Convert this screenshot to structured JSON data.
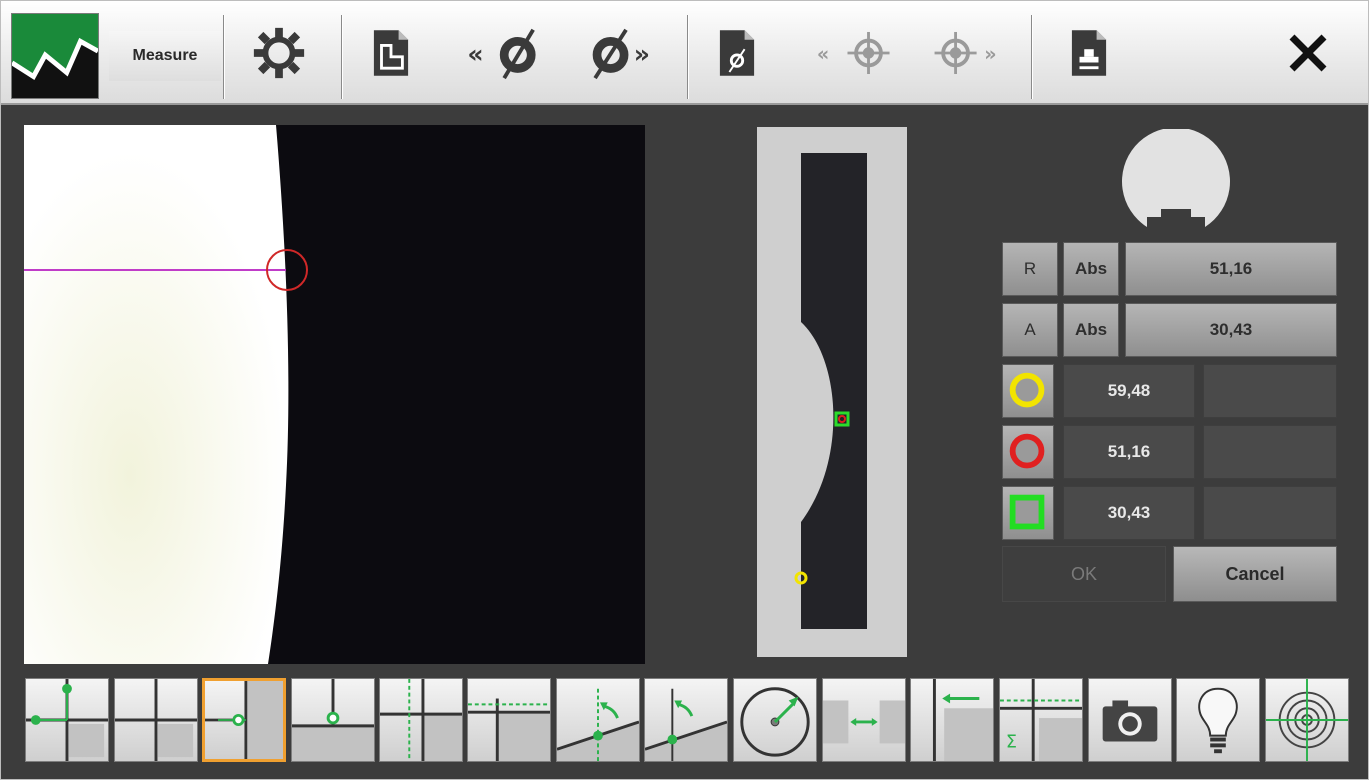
{
  "toolbar": {
    "measure_label": "Measure",
    "icons": [
      "logo-icon",
      "gear-icon",
      "new-document-icon",
      "previous-measurement-icon",
      "next-measurement-icon",
      "measurement-document-icon",
      "previous-target-icon",
      "next-target-icon",
      "print-icon",
      "close-icon"
    ]
  },
  "panel": {
    "r_label": "R",
    "r_mode": "Abs",
    "r_value": "51,16",
    "a_label": "A",
    "a_mode": "Abs",
    "a_value": "30,43",
    "results": [
      {
        "indicator": "yellow-circle",
        "color": "#f2e400",
        "value": "59,48"
      },
      {
        "indicator": "red-circle",
        "color": "#e02020",
        "value": "51,16"
      },
      {
        "indicator": "green-square",
        "color": "#22dd22",
        "value": "30,43"
      }
    ],
    "ok_label": "OK",
    "cancel_label": "Cancel"
  },
  "tools": [
    {
      "name": "cross-point-tool-icon"
    },
    {
      "name": "crosshair-tool-icon"
    },
    {
      "name": "edge-point-tool-icon",
      "active": true
    },
    {
      "name": "bottom-edge-point-tool-icon"
    },
    {
      "name": "vertical-line-tool-icon"
    },
    {
      "name": "horizontal-line-tool-icon"
    },
    {
      "name": "angle-tool-icon"
    },
    {
      "name": "angle-edge-tool-icon"
    },
    {
      "name": "radius-tool-icon"
    },
    {
      "name": "distance-tool-icon"
    },
    {
      "name": "offset-tool-icon"
    },
    {
      "name": "sum-tool-icon"
    },
    {
      "name": "camera-icon"
    },
    {
      "name": "lightbulb-icon"
    },
    {
      "name": "target-icon"
    }
  ],
  "colors": {
    "accent": "#f0a030",
    "tool_green": "#2bb24c",
    "crosshair": "#c03cc8"
  }
}
